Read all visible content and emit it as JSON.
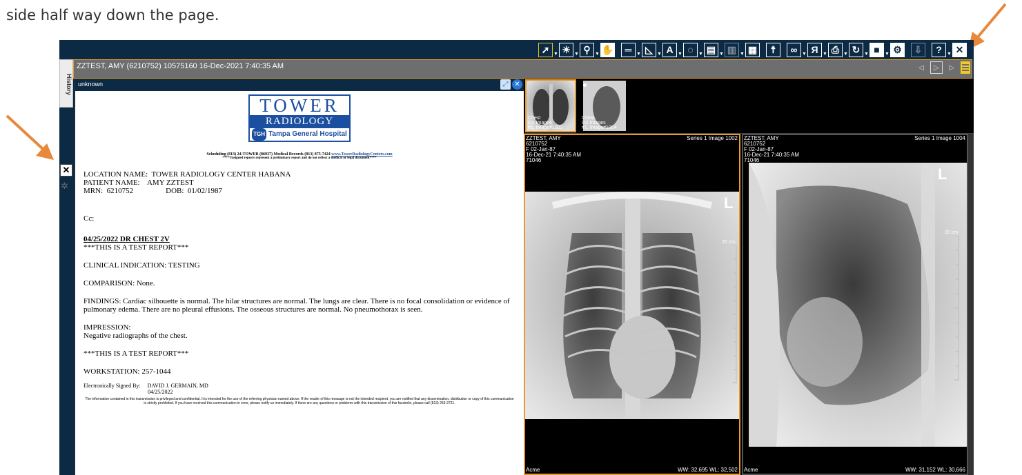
{
  "caption": "side half way down the page.",
  "accent_color": "#e39a2e",
  "toolbar": {
    "tools": [
      "select-tool",
      "window-level-tool",
      "zoom-tool",
      "pan-tool",
      "measure-tool",
      "cursor-tool",
      "text-tool",
      "roi-tool",
      "layout-tool",
      "series-tool",
      "compare-tool",
      "body-tool",
      "link-tool",
      "flip-tool",
      "print-tool",
      "rotate-tool",
      "fill-tool",
      "settings-tool",
      "download-tool",
      "help-tool",
      "close-tool"
    ],
    "close_label": "✕",
    "help_label": "?",
    "text_label": "A"
  },
  "info_bar": {
    "patient_line": "ZZTEST, AMY  (6210752)  10575160  16-Dec-2021 7:40:35 AM"
  },
  "sidebar": {
    "history_label": "History",
    "close_label": "✕"
  },
  "report": {
    "header_title": "unknown",
    "logo": {
      "line1": "TOWER",
      "line2": "RADIOLOGY",
      "tgh_badge": "TGH",
      "line3": "Tampa General Hospital"
    },
    "scheduling_text": "Scheduling (813) 24-TOWER (86937)   Medical Records (813) 875-7424 ",
    "scheduling_link": "www.TowerRadiologyCenters.com",
    "unsigned_notice": "****Unsigned reports represent a preliminary report and do not reflect a medical or legal document****",
    "location": "LOCATION NAME:  TOWER RADIOLOGY CENTER HABANA",
    "patient_name": "PATIENT NAME:    AMY ZZTEST",
    "mrn": "MRN:  6210752",
    "dob": "DOB:  01/02/1987",
    "cc": "Cc:",
    "exam_title": "04/25/2022 DR CHEST 2V",
    "test_report_1": "***THIS IS A TEST REPORT***",
    "clinical_indication": "CLINICAL INDICATION: TESTING",
    "comparison": "COMPARISON: None.",
    "findings": "FINDINGS: Cardiac silhouette is normal. The hilar structures are normal. The lungs are clear. There is no focal consolidation or evidence of pulmonary edema. There are no pleural effusions. The osseous structures are normal. No pneumothorax is seen.",
    "impression_label": "IMPRESSION:",
    "impression_text": "Negative radiographs of the chest.",
    "test_report_2": "***THIS IS A TEST REPORT***",
    "workstation": "WORKSTATION: 257-1044",
    "signed_by_label": "Electronically Signed By:",
    "signed_by_name": "DAVID J. GERMAIN, MD",
    "signed_date": "04/25/2022",
    "disclaimer": "The information contained in this transmission is privileged and confidential. It is intended for the use of the referring physician named above. If the reader of this message is not the intended recipient, you are notified that any dissemination, distribution or copy of this communication is strictly prohibited. If you have received this communication in error, please notify us immediately.  If there are any questions or problems with this transmission of this facsimile, please call (813) 253-2721."
  },
  "thumbnails": [
    {
      "line1": "Chest",
      "line2": "DX Images",
      "line3": "#1, Image#1002"
    },
    {
      "line1": "Chest",
      "line2": "DX Images",
      "line3": "#1, Image#1004"
    }
  ],
  "viewports": [
    {
      "patient": "ZZTEST, AMY",
      "id": "6210752",
      "sex_dob": "F 02-Jan-87",
      "study_date": "16-Dec-21 7:40:35 AM",
      "acc": "71046",
      "series": "Series 1 Image 1002",
      "marker": "L",
      "scale": "20 cm",
      "institution": "Acme",
      "wwwl": "WW: 32,695 WL: 32,502"
    },
    {
      "patient": "ZZTEST, AMY",
      "id": "6210752",
      "sex_dob": "F 02-Jan-87",
      "study_date": "16-Dec-21 7:40:35 AM",
      "acc": "71046",
      "series": "Series 1 Image 1004",
      "marker": "L",
      "scale": "20 cm",
      "institution": "Acme",
      "wwwl": "WW: 31,152 WL: 30,666"
    }
  ]
}
